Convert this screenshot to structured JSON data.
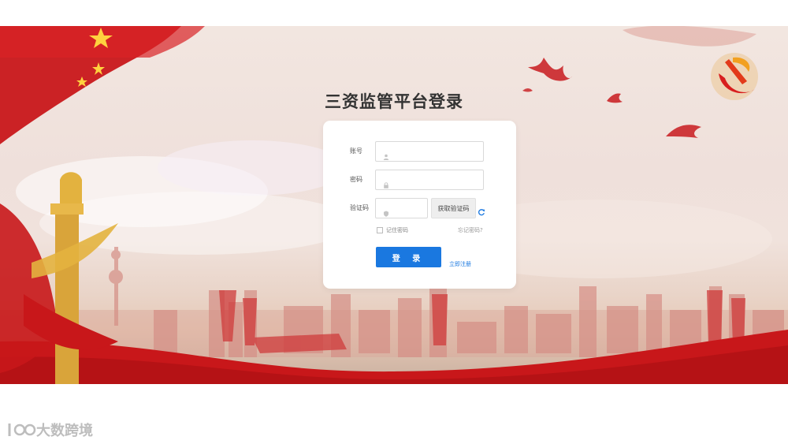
{
  "page": {
    "title": "三资监管平台登录"
  },
  "form": {
    "account_label": "账号",
    "account_value": "",
    "password_label": "密码",
    "password_value": "",
    "captcha_label": "验证码",
    "captcha_value": "",
    "captcha_button": "获取验证码",
    "remember_label": "记住密码",
    "forgot_link": "忘记密码?",
    "login_button": "登 录",
    "register_link": "立即注册"
  },
  "colors": {
    "primary": "#1a78e0",
    "banner_red": "#c8171a"
  },
  "icons": {
    "account": "user-icon",
    "password": "lock-icon",
    "captcha": "shield-icon",
    "refresh": "refresh-icon"
  },
  "watermark": {
    "text": "大数跨境"
  }
}
